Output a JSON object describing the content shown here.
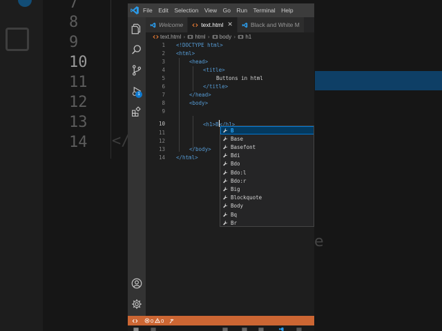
{
  "menu": [
    "File",
    "Edit",
    "Selection",
    "View",
    "Go",
    "Run",
    "Terminal",
    "Help"
  ],
  "activity_badge": "1",
  "tabs": [
    {
      "label": "Welcome",
      "active": false,
      "italic": true
    },
    {
      "label": "text.html",
      "active": true,
      "close": "✕"
    },
    {
      "label": "Black and White M",
      "active": false
    }
  ],
  "breadcrumb": [
    "text.html",
    "html",
    "body",
    "h1"
  ],
  "editor": {
    "lines": [
      {
        "n": "1",
        "code": "<!DOCTYPE html>"
      },
      {
        "n": "2",
        "code": "<html>"
      },
      {
        "n": "3",
        "code": "<head>"
      },
      {
        "n": "4",
        "code": "<title>"
      },
      {
        "n": "5",
        "code": "Buttons in html"
      },
      {
        "n": "6",
        "code": "</title>"
      },
      {
        "n": "7",
        "code": "</head>"
      },
      {
        "n": "8",
        "code": "<body>"
      },
      {
        "n": "9",
        "code": ""
      },
      {
        "n": "10",
        "code_before": "<h1>B",
        "code_after": "</h1>"
      },
      {
        "n": "11",
        "code": ""
      },
      {
        "n": "12",
        "code": ""
      },
      {
        "n": "13",
        "code": "</body>"
      },
      {
        "n": "14",
        "code": "</html>"
      }
    ]
  },
  "suggestions": [
    "B",
    "Base",
    "Basefont",
    "Bdi",
    "Bdo",
    "Bdo:l",
    "Bdo:r",
    "Big",
    "Blockquote",
    "Body",
    "Bq",
    "Br"
  ],
  "status": {
    "errors": "0",
    "warnings": "0"
  },
  "background": {
    "line_numbers": [
      "7",
      "8",
      "9",
      "10",
      "11",
      "12",
      "13",
      "14"
    ],
    "glyph_lt": "</",
    "glyph_e": "e"
  },
  "colors": {
    "statusbar": "#cc6633",
    "accent": "#0078d4",
    "tag": "#569cd6",
    "match": "#2aaaff"
  }
}
